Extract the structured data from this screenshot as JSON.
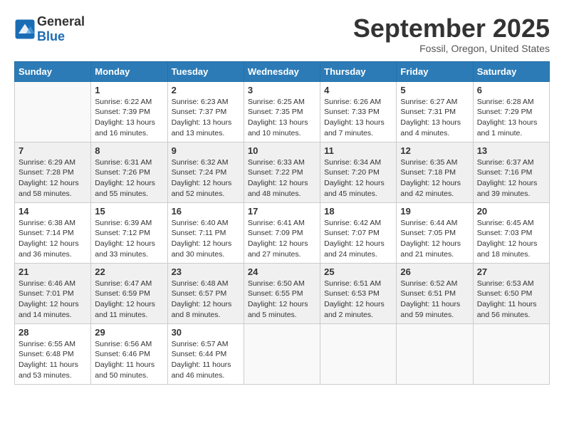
{
  "header": {
    "logo_general": "General",
    "logo_blue": "Blue",
    "month_title": "September 2025",
    "subtitle": "Fossil, Oregon, United States"
  },
  "weekdays": [
    "Sunday",
    "Monday",
    "Tuesday",
    "Wednesday",
    "Thursday",
    "Friday",
    "Saturday"
  ],
  "weeks": [
    [
      {
        "day": "",
        "empty": true
      },
      {
        "day": "1",
        "sunrise": "6:22 AM",
        "sunset": "7:39 PM",
        "daylight": "13 hours and 16 minutes."
      },
      {
        "day": "2",
        "sunrise": "6:23 AM",
        "sunset": "7:37 PM",
        "daylight": "13 hours and 13 minutes."
      },
      {
        "day": "3",
        "sunrise": "6:25 AM",
        "sunset": "7:35 PM",
        "daylight": "13 hours and 10 minutes."
      },
      {
        "day": "4",
        "sunrise": "6:26 AM",
        "sunset": "7:33 PM",
        "daylight": "13 hours and 7 minutes."
      },
      {
        "day": "5",
        "sunrise": "6:27 AM",
        "sunset": "7:31 PM",
        "daylight": "13 hours and 4 minutes."
      },
      {
        "day": "6",
        "sunrise": "6:28 AM",
        "sunset": "7:29 PM",
        "daylight": "13 hours and 1 minute."
      }
    ],
    [
      {
        "day": "7",
        "sunrise": "6:29 AM",
        "sunset": "7:28 PM",
        "daylight": "12 hours and 58 minutes."
      },
      {
        "day": "8",
        "sunrise": "6:31 AM",
        "sunset": "7:26 PM",
        "daylight": "12 hours and 55 minutes."
      },
      {
        "day": "9",
        "sunrise": "6:32 AM",
        "sunset": "7:24 PM",
        "daylight": "12 hours and 52 minutes."
      },
      {
        "day": "10",
        "sunrise": "6:33 AM",
        "sunset": "7:22 PM",
        "daylight": "12 hours and 48 minutes."
      },
      {
        "day": "11",
        "sunrise": "6:34 AM",
        "sunset": "7:20 PM",
        "daylight": "12 hours and 45 minutes."
      },
      {
        "day": "12",
        "sunrise": "6:35 AM",
        "sunset": "7:18 PM",
        "daylight": "12 hours and 42 minutes."
      },
      {
        "day": "13",
        "sunrise": "6:37 AM",
        "sunset": "7:16 PM",
        "daylight": "12 hours and 39 minutes."
      }
    ],
    [
      {
        "day": "14",
        "sunrise": "6:38 AM",
        "sunset": "7:14 PM",
        "daylight": "12 hours and 36 minutes."
      },
      {
        "day": "15",
        "sunrise": "6:39 AM",
        "sunset": "7:12 PM",
        "daylight": "12 hours and 33 minutes."
      },
      {
        "day": "16",
        "sunrise": "6:40 AM",
        "sunset": "7:11 PM",
        "daylight": "12 hours and 30 minutes."
      },
      {
        "day": "17",
        "sunrise": "6:41 AM",
        "sunset": "7:09 PM",
        "daylight": "12 hours and 27 minutes."
      },
      {
        "day": "18",
        "sunrise": "6:42 AM",
        "sunset": "7:07 PM",
        "daylight": "12 hours and 24 minutes."
      },
      {
        "day": "19",
        "sunrise": "6:44 AM",
        "sunset": "7:05 PM",
        "daylight": "12 hours and 21 minutes."
      },
      {
        "day": "20",
        "sunrise": "6:45 AM",
        "sunset": "7:03 PM",
        "daylight": "12 hours and 18 minutes."
      }
    ],
    [
      {
        "day": "21",
        "sunrise": "6:46 AM",
        "sunset": "7:01 PM",
        "daylight": "12 hours and 14 minutes."
      },
      {
        "day": "22",
        "sunrise": "6:47 AM",
        "sunset": "6:59 PM",
        "daylight": "12 hours and 11 minutes."
      },
      {
        "day": "23",
        "sunrise": "6:48 AM",
        "sunset": "6:57 PM",
        "daylight": "12 hours and 8 minutes."
      },
      {
        "day": "24",
        "sunrise": "6:50 AM",
        "sunset": "6:55 PM",
        "daylight": "12 hours and 5 minutes."
      },
      {
        "day": "25",
        "sunrise": "6:51 AM",
        "sunset": "6:53 PM",
        "daylight": "12 hours and 2 minutes."
      },
      {
        "day": "26",
        "sunrise": "6:52 AM",
        "sunset": "6:51 PM",
        "daylight": "11 hours and 59 minutes."
      },
      {
        "day": "27",
        "sunrise": "6:53 AM",
        "sunset": "6:50 PM",
        "daylight": "11 hours and 56 minutes."
      }
    ],
    [
      {
        "day": "28",
        "sunrise": "6:55 AM",
        "sunset": "6:48 PM",
        "daylight": "11 hours and 53 minutes."
      },
      {
        "day": "29",
        "sunrise": "6:56 AM",
        "sunset": "6:46 PM",
        "daylight": "11 hours and 50 minutes."
      },
      {
        "day": "30",
        "sunrise": "6:57 AM",
        "sunset": "6:44 PM",
        "daylight": "11 hours and 46 minutes."
      },
      {
        "day": "",
        "empty": true
      },
      {
        "day": "",
        "empty": true
      },
      {
        "day": "",
        "empty": true
      },
      {
        "day": "",
        "empty": true
      }
    ]
  ],
  "labels": {
    "sunrise": "Sunrise:",
    "sunset": "Sunset:",
    "daylight": "Daylight:"
  }
}
